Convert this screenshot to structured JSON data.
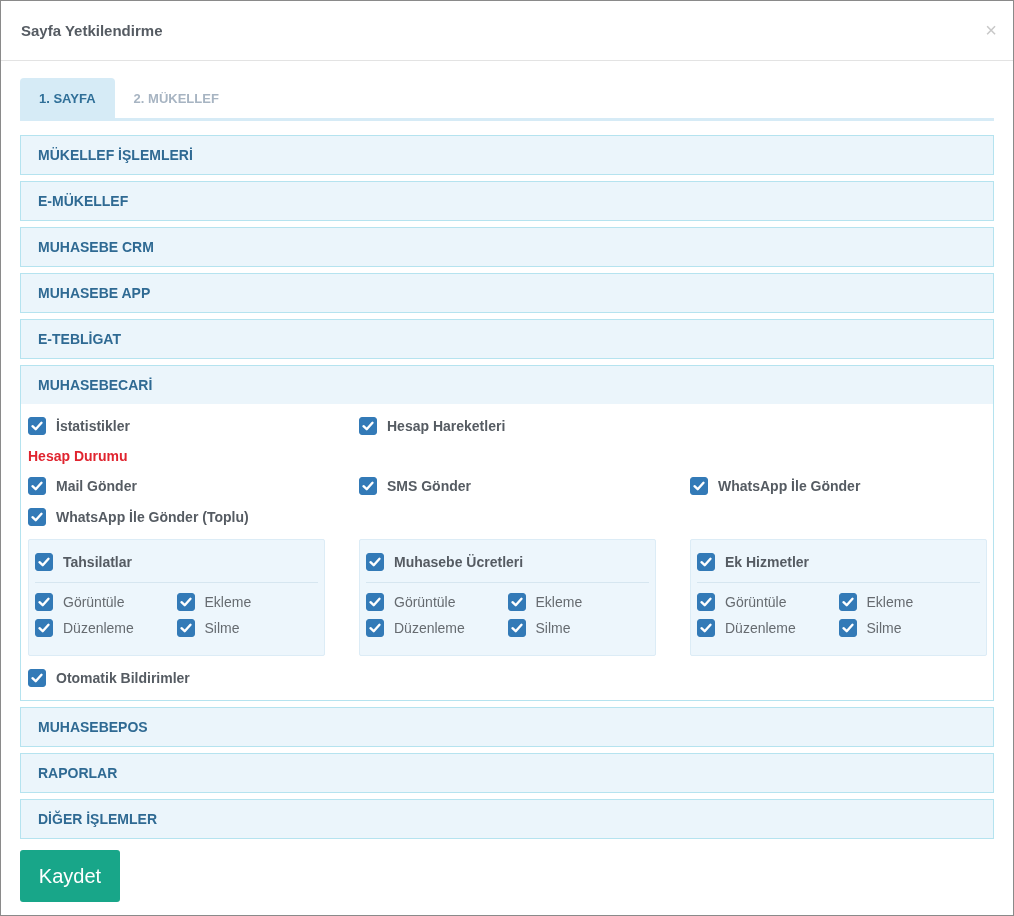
{
  "window": {
    "title": "Sayfa Yetkilendirme",
    "close": "×"
  },
  "tabs": [
    {
      "label": "1. SAYFA",
      "selected": true
    },
    {
      "label": "2. MÜKELLEF",
      "selected": false
    }
  ],
  "sections": [
    {
      "title": "MÜKELLEF İŞLEMLERİ",
      "expanded": false
    },
    {
      "title": "E-MÜKELLEF",
      "expanded": false
    },
    {
      "title": "MUHASEBE CRM",
      "expanded": false
    },
    {
      "title": "MUHASEBE APP",
      "expanded": false
    },
    {
      "title": "E-TEBLİGAT",
      "expanded": false
    },
    {
      "title": "MUHASEBECARİ",
      "expanded": true,
      "rows": [
        [
          {
            "kind": "checkbox",
            "label": "İstatistikler",
            "checked": true
          },
          {
            "kind": "checkbox",
            "label": "Hesap Hareketleri",
            "checked": true
          }
        ],
        [
          {
            "kind": "heading",
            "label": "Hesap Durumu"
          }
        ],
        [
          {
            "kind": "checkbox",
            "label": "Mail Gönder",
            "checked": true
          },
          {
            "kind": "checkbox",
            "label": "SMS Gönder",
            "checked": true
          },
          {
            "kind": "checkbox",
            "label": "WhatsApp İle Gönder",
            "checked": true
          }
        ],
        [
          {
            "kind": "checkbox",
            "label": "WhatsApp İle Gönder (Toplu)",
            "checked": true
          }
        ],
        [
          {
            "kind": "group",
            "label": "Tahsilatlar",
            "checked": true,
            "options": [
              {
                "label": "Görüntüle",
                "checked": true
              },
              {
                "label": "Ekleme",
                "checked": true
              },
              {
                "label": "Düzenleme",
                "checked": true
              },
              {
                "label": "Silme",
                "checked": true
              }
            ]
          },
          {
            "kind": "group",
            "label": "Muhasebe Ücretleri",
            "checked": true,
            "options": [
              {
                "label": "Görüntüle",
                "checked": true
              },
              {
                "label": "Ekleme",
                "checked": true
              },
              {
                "label": "Düzenleme",
                "checked": true
              },
              {
                "label": "Silme",
                "checked": true
              }
            ]
          },
          {
            "kind": "group",
            "label": "Ek Hizmetler",
            "checked": true,
            "options": [
              {
                "label": "Görüntüle",
                "checked": true
              },
              {
                "label": "Ekleme",
                "checked": true
              },
              {
                "label": "Düzenleme",
                "checked": true
              },
              {
                "label": "Silme",
                "checked": true
              }
            ]
          }
        ],
        [
          {
            "kind": "checkbox",
            "label": "Otomatik Bildirimler",
            "checked": true
          }
        ]
      ]
    },
    {
      "title": "MUHASEBEPOS",
      "expanded": false
    },
    {
      "title": "RAPORLAR",
      "expanded": false
    },
    {
      "title": "DİĞER İŞLEMLER",
      "expanded": false
    }
  ],
  "buttons": [
    {
      "label": "Kaydet"
    }
  ]
}
